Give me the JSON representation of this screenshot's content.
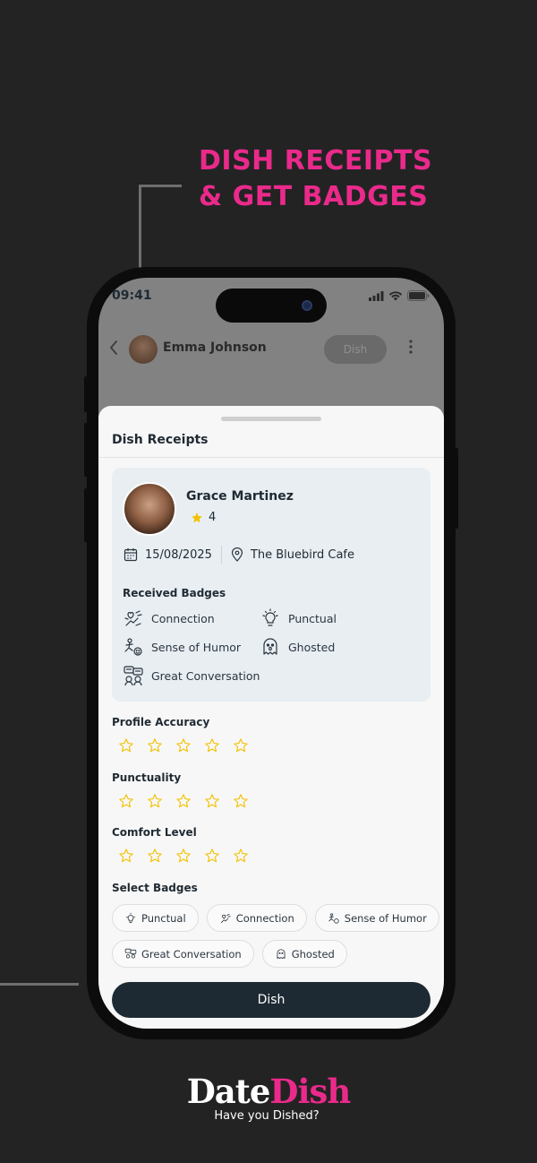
{
  "promo": {
    "headline_line1": "DISH RECEIPTS",
    "headline_line2": "& GET BADGES"
  },
  "status_bar": {
    "time": "09:41"
  },
  "chat_header": {
    "name": "Emma Johnson",
    "dish_label": "Dish",
    "back_icon": "chevron-left-icon",
    "more_icon": "more-vertical-icon"
  },
  "sheet": {
    "title": "Dish Receipts",
    "card": {
      "name": "Grace Martinez",
      "rating": "4",
      "date": "15/08/2025",
      "location": "The Bluebird Cafe",
      "received_badges_title": "Received Badges",
      "received_badges": [
        {
          "label": "Connection",
          "icon": "connection-icon"
        },
        {
          "label": "Punctual",
          "icon": "lightbulb-icon"
        },
        {
          "label": "Sense of Humor",
          "icon": "humor-icon"
        },
        {
          "label": "Ghosted",
          "icon": "ghost-icon"
        },
        {
          "label": "Great Conversation",
          "icon": "conversation-icon"
        }
      ]
    },
    "ratings": [
      {
        "label": "Profile Accuracy",
        "value": 0,
        "max": 5
      },
      {
        "label": "Punctuality",
        "value": 0,
        "max": 5
      },
      {
        "label": "Comfort Level",
        "value": 0,
        "max": 5
      }
    ],
    "select_badges_title": "Select Badges",
    "select_badges": [
      {
        "label": "Punctual",
        "icon": "lightbulb-icon"
      },
      {
        "label": "Connection",
        "icon": "connection-icon"
      },
      {
        "label": "Sense of Humor",
        "icon": "humor-icon"
      },
      {
        "label": "Great Conversation",
        "icon": "conversation-icon"
      },
      {
        "label": "Ghosted",
        "icon": "ghost-icon"
      }
    ],
    "submit_label": "Dish"
  },
  "brand": {
    "logo_part1": "Date",
    "logo_part2": "Dish",
    "tagline": "Have you Dished?"
  },
  "colors": {
    "accent": "#ea2a8b",
    "star": "#f2c200",
    "button": "#1e2a33",
    "background": "#232323"
  }
}
